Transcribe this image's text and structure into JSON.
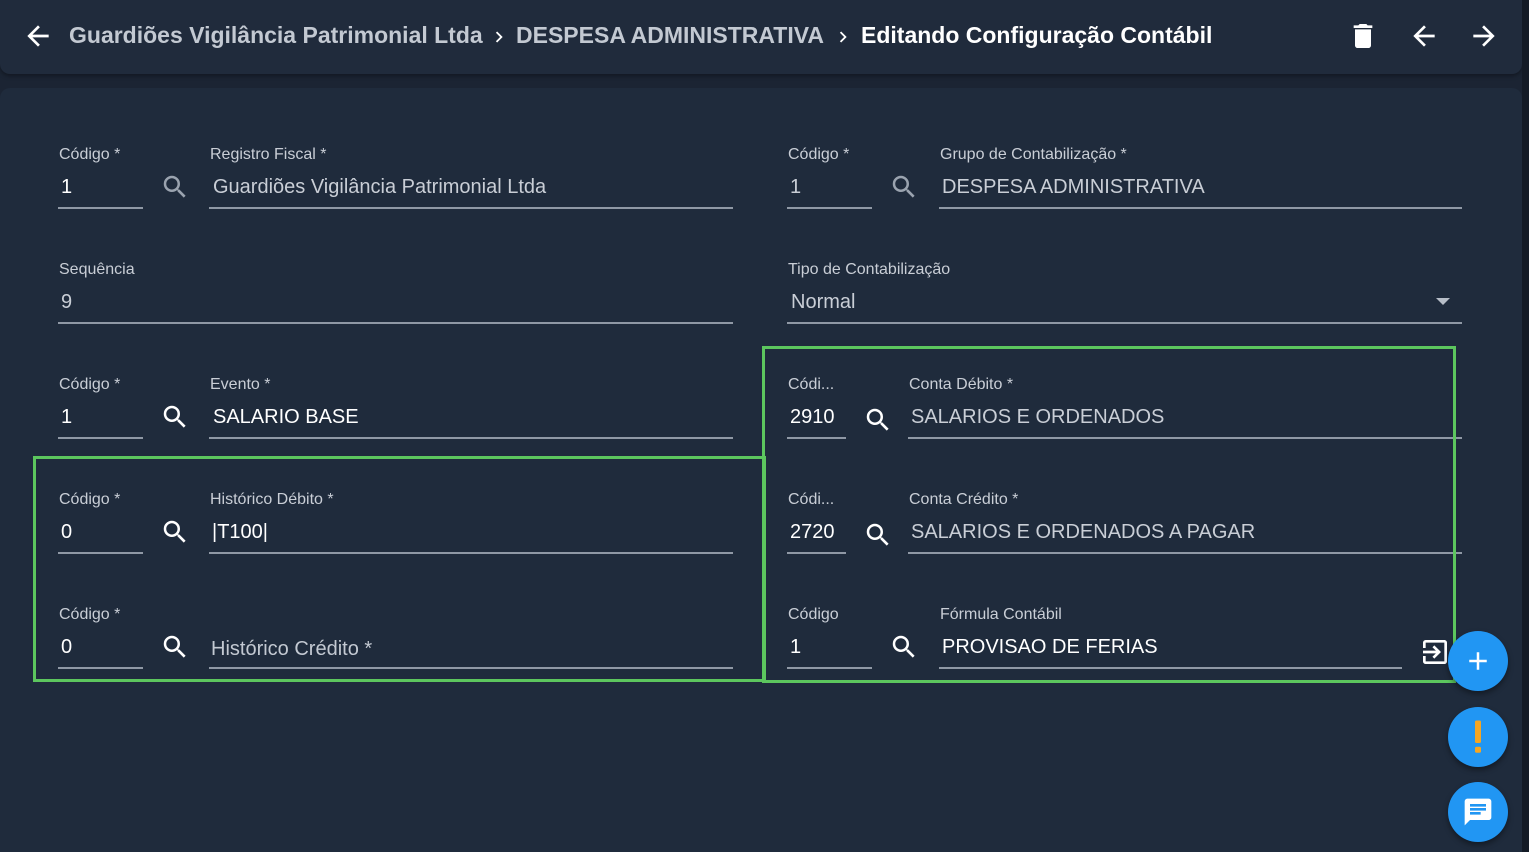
{
  "header": {
    "breadcrumb": [
      "Guardiões Vigilância Patrimonial Ltda",
      "DESPESA ADMINISTRATIVA",
      "Editando Configuração Contábil"
    ]
  },
  "form": {
    "codigo_registro": {
      "label": "Código *",
      "value": "1"
    },
    "registro_fiscal": {
      "label": "Registro Fiscal *",
      "value": "Guardiões Vigilância Patrimonial Ltda"
    },
    "codigo_grupo": {
      "label": "Código *",
      "value": "1"
    },
    "grupo_contabilizacao": {
      "label": "Grupo de Contabilização *",
      "value": "DESPESA ADMINISTRATIVA"
    },
    "sequencia": {
      "label": "Sequência",
      "value": "9"
    },
    "tipo_contabilizacao": {
      "label": "Tipo de Contabilização",
      "value": "Normal"
    },
    "codigo_evento": {
      "label": "Código *",
      "value": "1"
    },
    "evento": {
      "label": "Evento *",
      "value": "SALARIO BASE"
    },
    "codigo_conta_debito": {
      "label": "Códi...",
      "value": "2910"
    },
    "conta_debito": {
      "label": "Conta Débito *",
      "value": "SALARIOS E ORDENADOS"
    },
    "codigo_hist_debito": {
      "label": "Código *",
      "value": "0"
    },
    "historico_debito": {
      "label": "Histórico Débito *",
      "value": "|T100|"
    },
    "codigo_conta_credito": {
      "label": "Códi...",
      "value": "2720"
    },
    "conta_credito": {
      "label": "Conta Crédito *",
      "value": "SALARIOS E ORDENADOS A PAGAR"
    },
    "codigo_hist_credito": {
      "label": "Código *",
      "value": "0"
    },
    "historico_credito": {
      "placeholder": "Histórico Crédito *"
    },
    "codigo_formula": {
      "label": "Código",
      "value": "1"
    },
    "formula_contabil": {
      "label": "Fórmula Contábil",
      "value": "PROVISAO DE FERIAS"
    }
  },
  "colors": {
    "accent": "#2196f3",
    "highlight": "#5cc65e",
    "background": "#1f2b3c"
  },
  "icons": [
    "back-arrow-icon",
    "delete-icon",
    "previous-icon",
    "next-icon",
    "search-icon",
    "open-formula-icon",
    "add-icon",
    "warning-icon",
    "chat-icon"
  ]
}
